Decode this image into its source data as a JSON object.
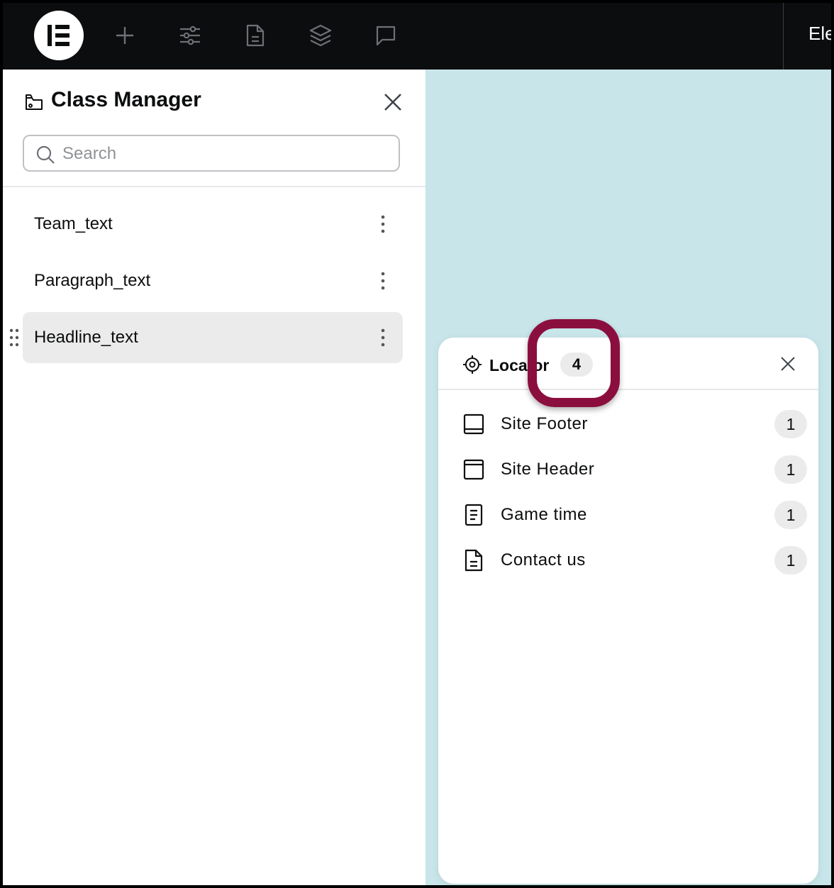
{
  "topbar": {
    "title_partial": "Ele",
    "icons": [
      "elementor-logo",
      "plus-icon",
      "sliders-icon",
      "document-icon",
      "layers-icon",
      "comment-icon"
    ]
  },
  "class_manager": {
    "title": "Class Manager",
    "search_placeholder": "Search",
    "items": [
      {
        "label": "Team_text",
        "selected": false
      },
      {
        "label": "Paragraph_text",
        "selected": false
      },
      {
        "label": "Headline_text",
        "selected": true
      }
    ]
  },
  "locator": {
    "title": "Locator",
    "count": "4",
    "rows": [
      {
        "label": "Site Footer",
        "count": "1",
        "icon": "footer-icon"
      },
      {
        "label": "Site Header",
        "count": "1",
        "icon": "header-icon"
      },
      {
        "label": "Game time",
        "count": "1",
        "icon": "page-icon"
      },
      {
        "label": "Contact us",
        "count": "1",
        "icon": "document-icon"
      }
    ]
  },
  "colors": {
    "topbar_bg": "#0c0d0e",
    "canvas_bg": "#c8e5ea",
    "highlight": "#8b0f3e"
  }
}
